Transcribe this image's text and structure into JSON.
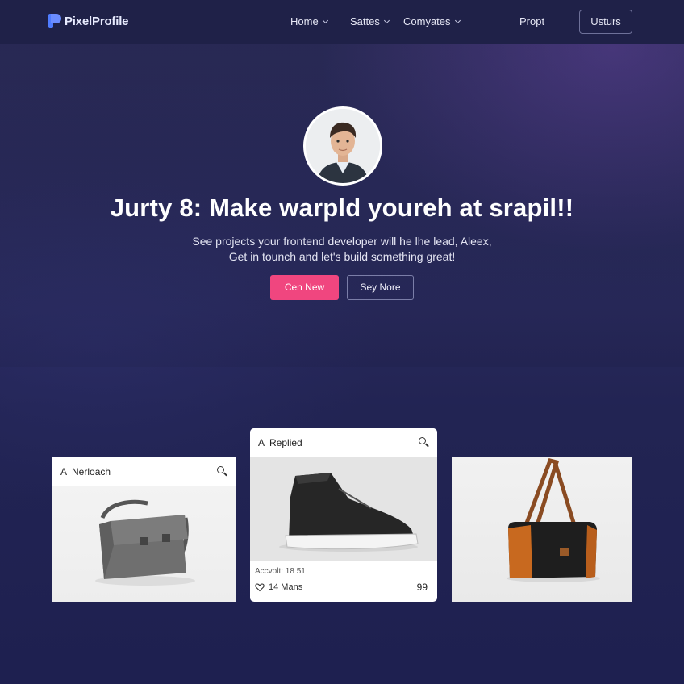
{
  "brand": {
    "name": "PixelProfile"
  },
  "nav": {
    "items": [
      {
        "label": "Home"
      },
      {
        "label": "Sattes"
      },
      {
        "label": "Comyates"
      },
      {
        "label": "Propt"
      }
    ],
    "cta_label": "Usturs"
  },
  "hero": {
    "title": "Jurty 8: Make warpld youreh at srapil!!",
    "subtitle_line1": "See projects your frontend developer will he lhe lead, Aleex,",
    "subtitle_line2": "Get in tounch and let's build something great!",
    "primary_button": "Cen New",
    "secondary_button": "Sey Nore"
  },
  "cards": [
    {
      "prefix": "A",
      "label": "Nerloach"
    },
    {
      "prefix": "A",
      "label": "Replied",
      "meta": "Accvolt: 18 51",
      "likes": "14 Mans",
      "count": "99"
    },
    {}
  ],
  "colors": {
    "background": "#1f2150",
    "accent": "#f0467f",
    "brand_blue": "#4f7cff"
  },
  "icons": [
    "logo-icon",
    "chevron-down-icon",
    "search-icon",
    "heart-icon"
  ]
}
